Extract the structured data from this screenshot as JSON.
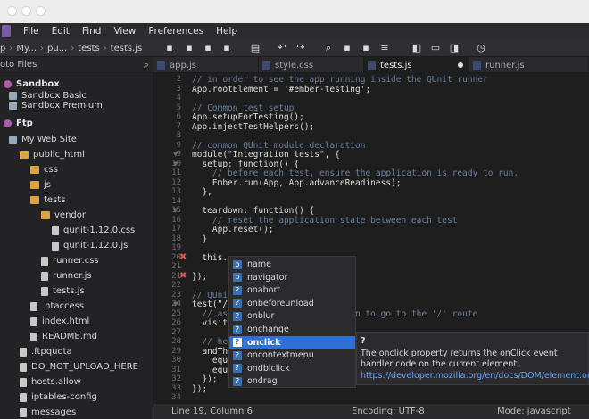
{
  "menubar": {
    "items": [
      "File",
      "Edit",
      "Find",
      "View",
      "Preferences",
      "Help"
    ]
  },
  "breadcrumb": [
    "p",
    "My...",
    "pu...",
    "tests",
    "tests.js"
  ],
  "panel_title": "oto Files",
  "tabs": [
    {
      "label": "app.js",
      "active": false
    },
    {
      "label": "style.css",
      "active": false
    },
    {
      "label": "tests.js",
      "active": true,
      "modified": true
    },
    {
      "label": "runner.js",
      "active": false
    }
  ],
  "sidebar": {
    "items": [
      {
        "label": "Sandbox",
        "kind": "section"
      },
      {
        "label": "Sandbox Basic",
        "kind": "server"
      },
      {
        "label": "Sandbox Premium",
        "kind": "server"
      },
      {
        "label": "Ftp",
        "kind": "section"
      },
      {
        "label": "My Web Site",
        "kind": "server"
      },
      {
        "label": "public_html",
        "kind": "folder"
      },
      {
        "label": "css",
        "kind": "folder"
      },
      {
        "label": "js",
        "kind": "folder"
      },
      {
        "label": "tests",
        "kind": "folder"
      },
      {
        "label": "vendor",
        "kind": "folder"
      },
      {
        "label": "qunit-1.12.0.css",
        "kind": "file"
      },
      {
        "label": "qunit-1.12.0.js",
        "kind": "file"
      },
      {
        "label": "runner.css",
        "kind": "file"
      },
      {
        "label": "runner.js",
        "kind": "file"
      },
      {
        "label": "tests.js",
        "kind": "file"
      },
      {
        "label": ".htaccess",
        "kind": "file"
      },
      {
        "label": "index.html",
        "kind": "file"
      },
      {
        "label": "README.md",
        "kind": "file"
      },
      {
        "label": ".ftpquota",
        "kind": "file"
      },
      {
        "label": "DO_NOT_UPLOAD_HERE",
        "kind": "file"
      },
      {
        "label": "hosts.allow",
        "kind": "file"
      },
      {
        "label": "iptables-config",
        "kind": "file"
      },
      {
        "label": "messages",
        "kind": "file"
      }
    ]
  },
  "editor": {
    "lines": [
      {
        "n": "2",
        "text": "// in order to see the app running inside the QUnit runner"
      },
      {
        "n": "3",
        "text": "App.rootElement = '#ember-testing';"
      },
      {
        "n": "4",
        "text": ""
      },
      {
        "n": "5",
        "text": "// Common test setup"
      },
      {
        "n": "6",
        "text": "App.setupForTesting();"
      },
      {
        "n": "7",
        "text": "App.injectTestHelpers();"
      },
      {
        "n": "8",
        "text": ""
      },
      {
        "n": "9",
        "text": "// common QUnit module declaration"
      },
      {
        "n": "9",
        "text": "module(\"Integration tests\", {"
      },
      {
        "n": "10",
        "text": "  setup: function() {"
      },
      {
        "n": "11",
        "text": "    // before each test, ensure the application is ready to run."
      },
      {
        "n": "12",
        "text": "    Ember.run(App, App.advanceReadiness);"
      },
      {
        "n": "13",
        "text": "  },"
      },
      {
        "n": "14",
        "text": ""
      },
      {
        "n": "15",
        "text": "  teardown: function() {"
      },
      {
        "n": "16",
        "text": "    // reset the application state between each test"
      },
      {
        "n": "17",
        "text": "    App.reset();"
      },
      {
        "n": "18",
        "text": "  }"
      },
      {
        "n": "19",
        "text": ""
      },
      {
        "n": "20",
        "text": "  this."
      },
      {
        "n": "21",
        "text": ""
      },
      {
        "n": "21",
        "text": "});"
      },
      {
        "n": "22",
        "text": ""
      },
      {
        "n": "23",
        "text": "// QUnit"
      },
      {
        "n": "24",
        "text": "test(\"/\""
      },
      {
        "n": "25",
        "text": "  // as                     ation to go to the '/' route"
      },
      {
        "n": "26",
        "text": "  visit("
      },
      {
        "n": "27",
        "text": ""
      },
      {
        "n": "28",
        "text": "  // hel"
      },
      {
        "n": "29",
        "text": "  andThe"
      },
      {
        "n": "30",
        "text": "    equa"
      },
      {
        "n": "31",
        "text": "    equa"
      },
      {
        "n": "32",
        "text": "  });"
      },
      {
        "n": "33",
        "text": "});"
      },
      {
        "n": "34",
        "text": ""
      }
    ]
  },
  "autocomplete": {
    "items": [
      {
        "badge": "o",
        "label": "name"
      },
      {
        "badge": "o",
        "label": "navigator"
      },
      {
        "badge": "?",
        "label": "onabort"
      },
      {
        "badge": "?",
        "label": "onbeforeunload"
      },
      {
        "badge": "?",
        "label": "onblur"
      },
      {
        "badge": "?",
        "label": "onchange"
      },
      {
        "badge": "?",
        "label": "onclick",
        "selected": true
      },
      {
        "badge": "?",
        "label": "oncontextmenu"
      },
      {
        "badge": "?",
        "label": "ondblclick"
      },
      {
        "badge": "?",
        "label": "ondrag"
      }
    ]
  },
  "doc_popup": {
    "title": "?",
    "text": "The onclick property returns the onClick event handler code on the current element.",
    "link": "https://developer.mozilla.org/en/docs/DOM/element.onclick"
  },
  "status": {
    "position": "Line 19, Column 6",
    "encoding": "Encoding: UTF-8",
    "mode": "Mode: javascript"
  }
}
